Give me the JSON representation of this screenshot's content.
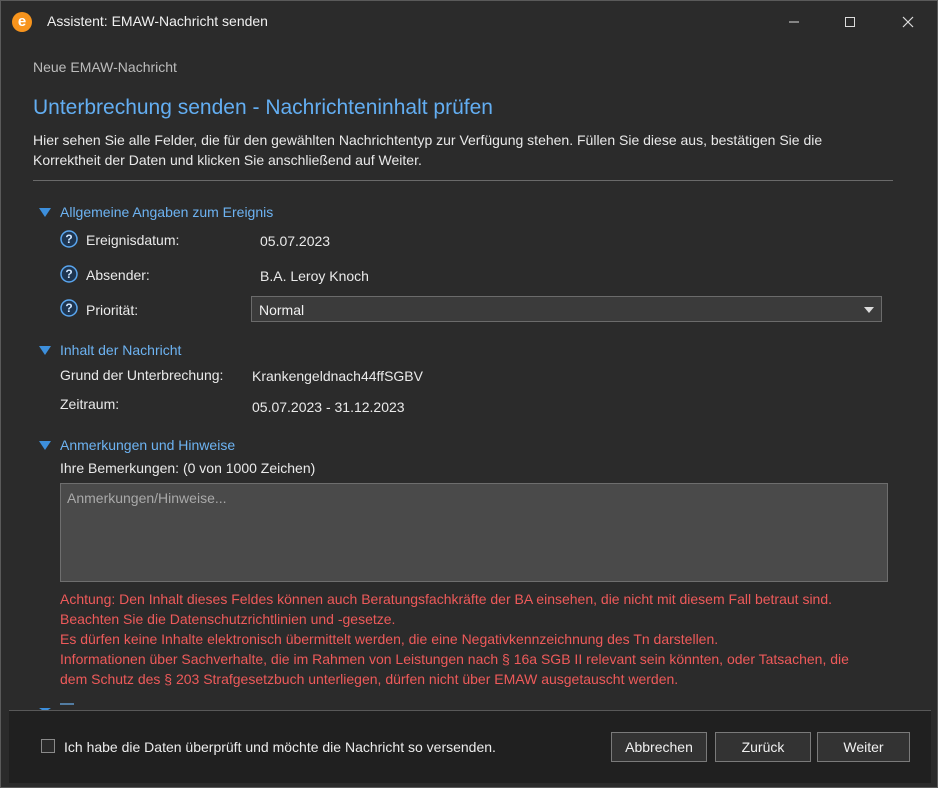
{
  "window": {
    "title": "Assistent: EMAW-Nachricht senden",
    "logo_letter": "e",
    "controls": [
      "minimize-icon",
      "maximize-icon",
      "close-icon"
    ]
  },
  "subtitle": "Neue EMAW-Nachricht",
  "page_title": "Unterbrechung senden - Nachrichteninhalt prüfen",
  "intro_lines": [
    "Hier sehen Sie alle Felder, die für den gewählten Nachrichtentyp zur Verfügung stehen. Füllen Sie diese aus, bestätigen Sie die",
    "Korrektheit der Daten und klicken Sie anschließend auf Weiter."
  ],
  "sections": {
    "general": {
      "title": "Allgemeine Angaben zum Ereignis",
      "fields": [
        {
          "label": "Ereignisdatum:",
          "value": "05.07.2023"
        },
        {
          "label": "Absender:",
          "value": "B.A. Leroy Knoch"
        },
        {
          "label": "Priorität:",
          "value": "Normal"
        }
      ]
    },
    "content": {
      "title": "Inhalt der Nachricht",
      "fields": [
        {
          "label": "Grund der Unterbrechung:",
          "value": "Krankengeldnach44ffSGBV"
        },
        {
          "label": "Zeitraum:",
          "value": "05.07.2023 - 31.12.2023"
        }
      ]
    },
    "remarks": {
      "title": "Anmerkungen und Hinweise",
      "label": "Ihre Bemerkungen: (0 von 1000 Zeichen)",
      "placeholder": "Anmerkungen/Hinweise...",
      "value": "",
      "warning_lines": [
        "Achtung: Den Inhalt dieses Feldes können auch Beratungsfachkräfte der BA einsehen, die nicht mit diesem Fall betraut sind.",
        "Beachten Sie die Datenschutzrichtlinien und -gesetze.",
        "Es dürfen keine Inhalte elektronisch übermittelt werden, die eine Negativkennzeichnung des Tn darstellen.",
        "Informationen über Sachverhalte, die im Rahmen von Leistungen nach § 16a SGB II relevant sein könnten, oder Tatsachen, die",
        "dem Schutz des § 203 Strafgesetzbuch unterliegen, dürfen nicht über EMAW ausgetauscht werden."
      ]
    }
  },
  "footer": {
    "confirm_label": "Ich habe die Daten überprüft und möchte die Nachricht so versenden.",
    "confirm_checked": false,
    "buttons": {
      "cancel": "Abbrechen",
      "back": "Zurück",
      "next": "Weiter"
    }
  },
  "colors": {
    "accent": "#63aef2",
    "warning": "#ee5a5a",
    "background": "#2b2b2b",
    "logo": "#f7941d"
  }
}
